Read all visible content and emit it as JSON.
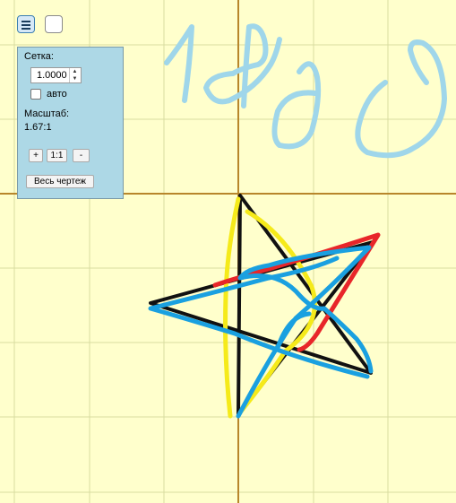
{
  "toolbar": {
    "menu_icon": "hamburger-icon"
  },
  "panel": {
    "grid_label": "Сетка:",
    "grid_value": "1.0000",
    "auto_label": "авто",
    "auto_checked": false,
    "scale_label": "Масштаб:",
    "scale_value": "1.67:1",
    "zoom_in_label": "+",
    "reset_label": "1:1",
    "zoom_out_label": "-",
    "fit_label": "Весь чертеж"
  },
  "canvas": {
    "background_color": "#ffffcc",
    "grid_color": "#d9dca0",
    "axis_color": "#b8862b",
    "stroke_colors": {
      "black": "#111111",
      "yellow": "#f5ea1a",
      "red": "#e8262a",
      "blue": "#1aa0e0",
      "light_blue": "#9fd6ea"
    },
    "handwritten_text": "1900"
  }
}
